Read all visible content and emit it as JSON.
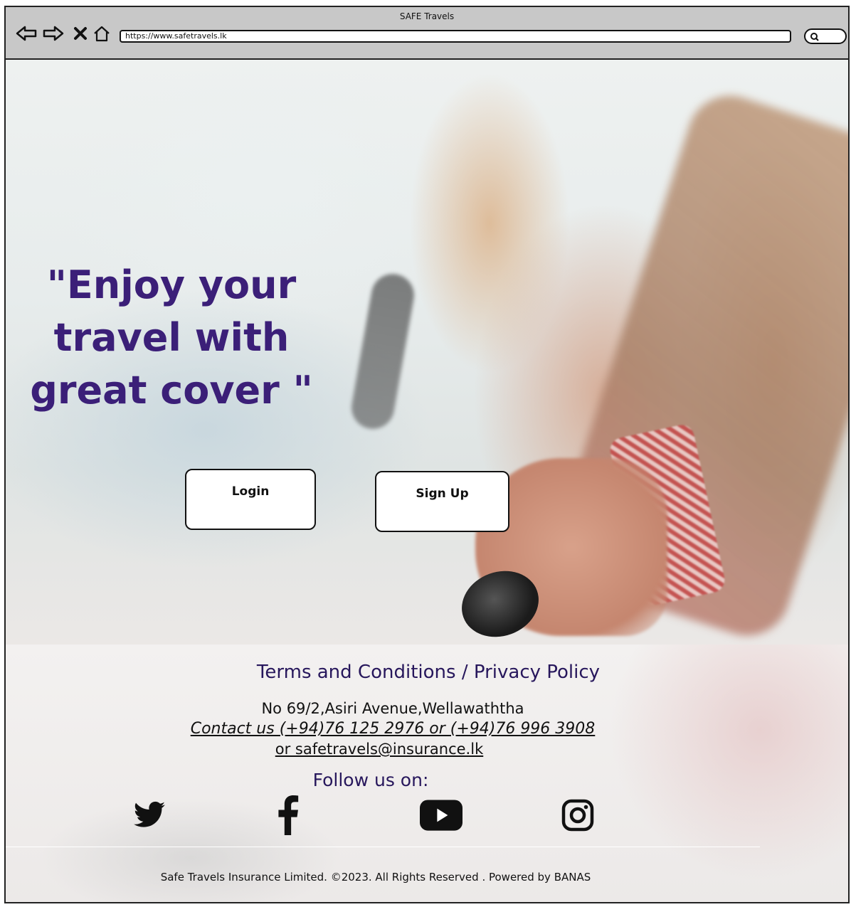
{
  "browser": {
    "title": "SAFE Travels",
    "url": "https://www.safetravels.lk",
    "icons": [
      "back-arrow-icon",
      "forward-arrow-icon",
      "close-icon",
      "home-icon",
      "search-icon"
    ]
  },
  "hero": {
    "headline": "\"Enjoy your travel with great cover \"",
    "login_label": "Login",
    "signup_label": "Sign Up",
    "headline_color": "#3b1f78"
  },
  "footer": {
    "terms_label": "Terms and Conditions",
    "separator": " / ",
    "privacy_label": "Privacy Policy",
    "address": "No 69/2,Asiri Avenue,Wellawaththa",
    "contact": "Contact us (+94)76 125 2976 or (+94)76 996 3908",
    "email": "or  safetravels@insurance.lk",
    "follow_label": "Follow us on:",
    "social_icons": [
      "twitter-icon",
      "facebook-icon",
      "youtube-icon",
      "instagram-icon"
    ],
    "copyright": "Safe Travels Insurance Limited. ©2023. All Rights Reserved . Powered by BANAS",
    "link_color": "#27175c"
  }
}
